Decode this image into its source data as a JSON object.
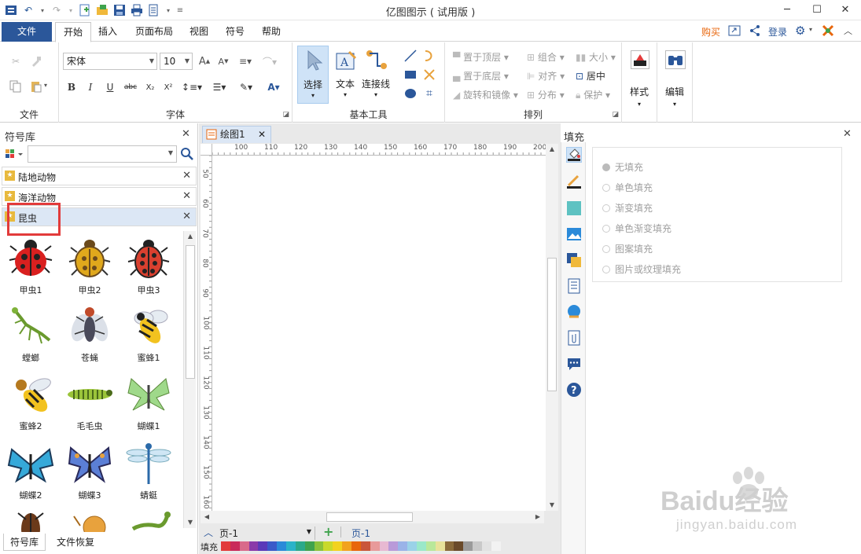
{
  "app": {
    "title": "亿图图示 ( 试用版 )"
  },
  "menu": {
    "file": "文件",
    "tabs": [
      "开始",
      "插入",
      "页面布局",
      "视图",
      "符号",
      "帮助"
    ],
    "buy": "购买",
    "login": "登录"
  },
  "ribbon": {
    "groups": {
      "file": "文件",
      "font": "字体",
      "basic_tools": "基本工具",
      "arrange": "排列"
    },
    "font_name": "宋体",
    "font_size": "10",
    "tools": {
      "select": "选择",
      "text": "文本",
      "connector": "连接线"
    },
    "arrange": {
      "bring_front": "置于顶层",
      "send_back": "置于底层",
      "rotate_mirror": "旋转和镜像",
      "group": "组合",
      "align": "对齐",
      "distribute": "分布",
      "size": "大小",
      "center": "居中",
      "protect": "保护"
    },
    "style": "样式",
    "edit": "编辑"
  },
  "library": {
    "title": "符号库",
    "search_placeholder": "",
    "categories": [
      {
        "label": "陆地动物"
      },
      {
        "label": "海洋动物"
      },
      {
        "label": "昆虫"
      }
    ],
    "symbols": [
      "甲虫1",
      "甲虫2",
      "甲虫3",
      "螳螂",
      "苍蝇",
      "蜜蜂1",
      "蜜蜂2",
      "毛毛虫",
      "蝴蝶1",
      "蝴蝶2",
      "蝴蝶3",
      "蜻蜓"
    ],
    "bottom_tabs": [
      "符号库",
      "文件恢复"
    ]
  },
  "document": {
    "tab": "绘图1",
    "hruler": [
      "100",
      "110",
      "120",
      "130",
      "140",
      "150",
      "160",
      "170",
      "180",
      "190",
      "200"
    ],
    "vruler": [
      "50",
      "60",
      "70",
      "80",
      "90",
      "100",
      "110",
      "120",
      "130",
      "140",
      "150",
      "160"
    ],
    "page_select": "页-1",
    "page_tab": "页-1",
    "fill_label": "填充"
  },
  "fill_panel": {
    "title": "填充",
    "options": [
      "无填充",
      "单色填充",
      "渐变填充",
      "单色渐变填充",
      "图案填充",
      "图片或纹理填充"
    ]
  },
  "watermark": {
    "brand": "Baidu经验",
    "url": "jingyan.baidu.com"
  },
  "colors": {
    "accent": "#2b579a",
    "highlight": "#e23b3b",
    "buy": "#e8660c"
  }
}
